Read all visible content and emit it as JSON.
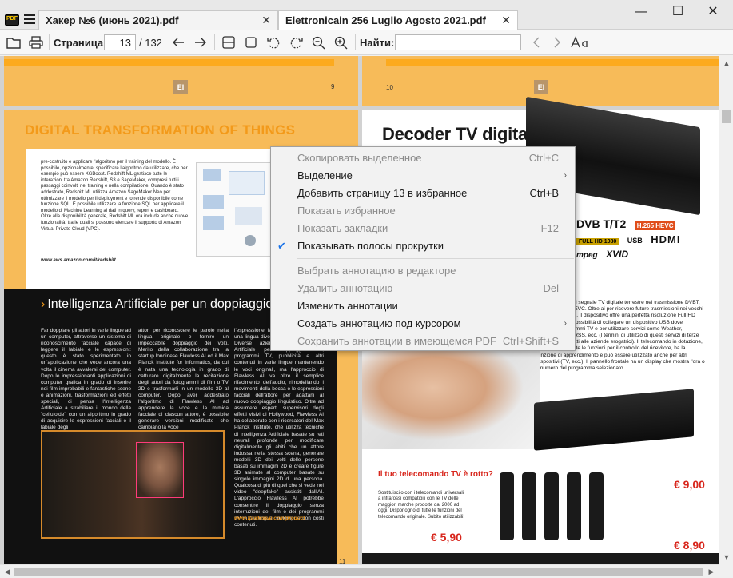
{
  "titlebar": {
    "logo_text": "PDF",
    "tabs": [
      {
        "label": "Хакер №6 (июнь 2021).pdf",
        "close": "✕"
      },
      {
        "label": "Elettronicain 256 Luglio Agosto 2021.pdf",
        "close": "✕"
      }
    ],
    "minimize": "—",
    "maximize": "☐",
    "close": "✕"
  },
  "toolbar": {
    "page_label": "Страница:",
    "page_value": "13",
    "page_total": "/ 132",
    "find_label": "Найти:",
    "find_value": ""
  },
  "left_page": {
    "top_page_number": "9",
    "logo_text": "EI",
    "dt_title": "DIGITAL TRANSFORMATION OF THINGS",
    "dt_text": "pre-costruito e applicare l'algoritmo per il training del modello. È possibile, opzionalmente, specificare l'algoritmo da utilizzare, che per esempio può essere XGBoost. Redshift ML gestisce tutte le interazioni tra Amazon Redshift, S3 e SageMaker, compresi tutti i passaggi coinvolti nel training e nella compilazione. Quando è stato addestrato, Redshift ML utilizza Amazon SageMaker Neo per ottimizzare il modello per il deployment e lo rende disponibile come funzione SQL. È possibile utilizzare la funzione SQL per applicare il modello di Machine Learning ai dati in query, report e dashboard. Oltre alla disponibilità generale, Redshift ML ora include anche nuove funzionalità, tra le quali si possono elencare il supporto di Amazon Virtual Private Cloud (VPC).",
    "dt_url": "www.aws.amazon.com/it/redshift",
    "ai_arrow": "›",
    "ai_title": "Intelligenza Artificiale per un doppiaggio in",
    "ai_col1": "Far doppiare gli attori in varie lingue ad un computer, attraverso un sistema di riconoscimento facciale capace di leggere il labiale e le espressioni: questo è stato sperimentato in un'applicazione che vede ancora una volta il cinema avvalersi del computer. Dopo le impressionanti applicazioni di computer grafica in grado di inserire nei film improbabili e fantastiche scene e animazioni, trasformazioni ed effetti speciali, ci pensa l'Intelligenza Artificiale a strabiliare il mondo della \"celluloide\" con un algoritmo in grado di acquisire le espressioni facciali e il labiale degli",
    "ai_col2": "attori per riconoscere le parole nella lingua originale e fornire un impeccabile doppiaggio dei volti. Merito della collaborazione tra la startup londinese Flawless AI ed il Max Planck Institute for Informatics, da cui è nata una tecnologia in grado di catturare digitalmente la recitazione degli attori da fotogrammi di film o TV 2D e trasformarli in un modello 3D al computer. Dopo aver addestrato l'algoritmo di Flawless AI ad apprendere la voce e la mimica facciale di ciascun attore, è possibile generare versioni modificate che cambiano la voce",
    "ai_col3": "l'espressione facciale per ottenere a una lingua diversa da quella originale. Diverse aziende di Intelligenza Artificiale per doppiaggio film, programmi TV, pubblicità e altri contenuti in varie lingue mantenendo le voci originali, ma l'approccio di Flawless AI va oltre il semplice rifacimento dell'audio, rimodellando i movimenti della bocca e le espressioni facciali dell'attore per adattarli al nuovo doppiaggio linguistico. Oltre ad assumere esperti supervisori degli effetti visivi di Hollywood, Flawless AI ha collaborato con i ricercatori del Max Planck Institute, che utilizza tecniche di Intelligenza Artificiale basate su reti neurali profonde per modificare digitalmente gli abiti che un attore indossa nella stessa scena, generare modelli 3D dei volti delle persone basati su immagini 2D e creare figure 3D animate al computer basate su singole immagini 2D di una persona. Qualcosa di più di quel che si vede nei video \"deepfake\" assistiti dall'AI. L'approccio Flawless AI potrebbe consentire il doppiaggio senza interruzioni dei film e dei programmi TV in più lingue, in tempi e con costi contenuti.",
    "ai_url": "www.flawlessai.com/product",
    "bottom_page_number": "11"
  },
  "right_page": {
    "top_page_number": "10",
    "logo_text": "EI",
    "title": "Decoder TV digitale",
    "logos": [
      "DVB T/T2",
      "H.265 HEVC",
      "FULL HD 1080",
      "USB",
      "HDMI",
      "mpeg",
      "XVID"
    ],
    "text": "ma per ricevere il segnale TV digitale terrestre nel trasmissione DVBT, DVBT2 H.265/HEVC. Oltre ai per ricevere future trasmissioni nei vecchi H.264 e MPEG-4. Il dispositivo offre una perfetta risoluzione Full HD 1080P. Offre la possibilità di collegare un dispositivo USB dove registrare programmi TV e per utilizzare servizi come Weather, YouTube, IPTV, RSS, ecc. (I termini di utilizzo di questi servizi di terze parti sono soggetti alle aziende erogatrici). Il telecomando in dotazione, oltre ad avere tutte le funzioni per il controllo del ricevitore, ha la funzione di apprendimento e può essere utilizzato anche per altri dispositivi (TV, ecc.). Il pannello frontale ha un display che mostra l'ora o il numero del programma selezionato.",
    "ad_title": "Il tuo telecomando TV è rotto?",
    "ad_text": "Sostituiscilo con i telecomandi universali a infrarossi compatibili con le TV delle maggiori marche prodotte dal 2000 ad oggi. Disponogno di tutte le funzioni del telecomando originale. Subito utilizzabili!",
    "price1": "€ 5,90",
    "price2": "€ 9,00",
    "price3": "€ 8,90"
  },
  "context_menu": {
    "items": [
      {
        "label": "Скопировать выделенное",
        "shortcut": "Ctrl+C",
        "disabled": true
      },
      {
        "label": "Выделение",
        "submenu": "›"
      },
      {
        "label": "Добавить страницу 13 в избранное",
        "shortcut": "Ctrl+B"
      },
      {
        "label": "Показать избранное",
        "disabled": true
      },
      {
        "label": "Показать закладки",
        "shortcut": "F12",
        "disabled": true
      },
      {
        "label": "Показывать полосы прокрутки",
        "checked": true
      },
      {
        "label": "Выбрать аннотацию в редакторе",
        "disabled": true
      },
      {
        "label": "Удалить аннотацию",
        "shortcut": "Del",
        "disabled": true
      },
      {
        "label": "Изменить аннотации"
      },
      {
        "label": "Создать аннотацию под курсором",
        "submenu": "›"
      },
      {
        "label": "Сохранить аннотации в имеющемся PDF",
        "shortcut": "Ctrl+Shift+S",
        "disabled": true
      }
    ],
    "check_mark": "✔"
  },
  "colors": {
    "accent_orange": "#f39a1a",
    "page_orange": "#f7bb59",
    "check_blue": "#1a73e8"
  }
}
